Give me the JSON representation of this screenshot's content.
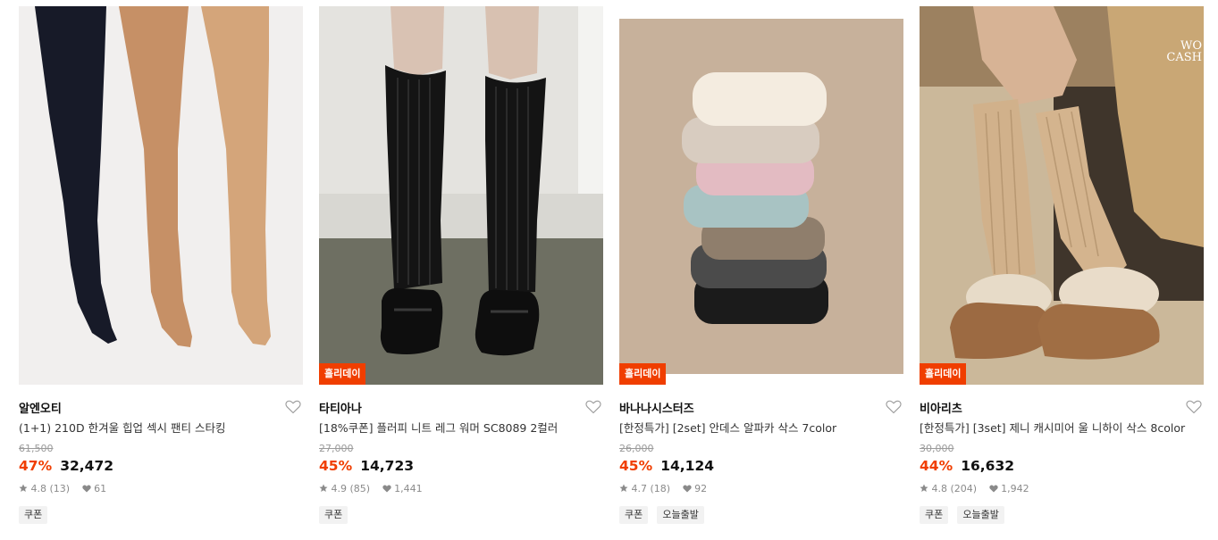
{
  "products": [
    {
      "brand": "알엔오티",
      "title": "(1+1) 210D 한겨울 힙업 섹시 팬티 스타킹",
      "original_price": "61,500",
      "discount": "47%",
      "price": "32,472",
      "rating": "4.8",
      "reviews": "(13)",
      "likes": "61",
      "tags": [
        "쿠폰"
      ]
    },
    {
      "badge": "홀리데이",
      "brand": "타티아나",
      "title": "[18%쿠폰] 플러피 니트 레그 워머 SC8089 2컬러",
      "original_price": "27,000",
      "discount": "45%",
      "price": "14,723",
      "rating": "4.9",
      "reviews": "(85)",
      "likes": "1,441",
      "tags": [
        "쿠폰"
      ]
    },
    {
      "badge": "홀리데이",
      "brand": "바나나시스터즈",
      "title": "[한정특가] [2set] 안데스 알파카 삭스 7color",
      "original_price": "26,000",
      "discount": "45%",
      "price": "14,124",
      "rating": "4.7",
      "reviews": "(18)",
      "likes": "92",
      "tags": [
        "쿠폰",
        "오늘출발"
      ]
    },
    {
      "badge": "홀리데이",
      "brand": "비아리츠",
      "title": "[한정특가] [3set] 제니 캐시미어 울 니하이 삭스 8color",
      "original_price": "30,000",
      "discount": "44%",
      "price": "16,632",
      "rating": "4.8",
      "reviews": "(204)",
      "likes": "1,942",
      "tags": [
        "쿠폰",
        "오늘출발"
      ]
    }
  ],
  "image_watermark": "WO CASH",
  "colors": {
    "accent": "#f03e00",
    "star": "#8a8a8a"
  },
  "icons": {
    "like": "heart-outline-icon",
    "rating": "star-icon",
    "likes_count": "heart-filled-icon"
  }
}
